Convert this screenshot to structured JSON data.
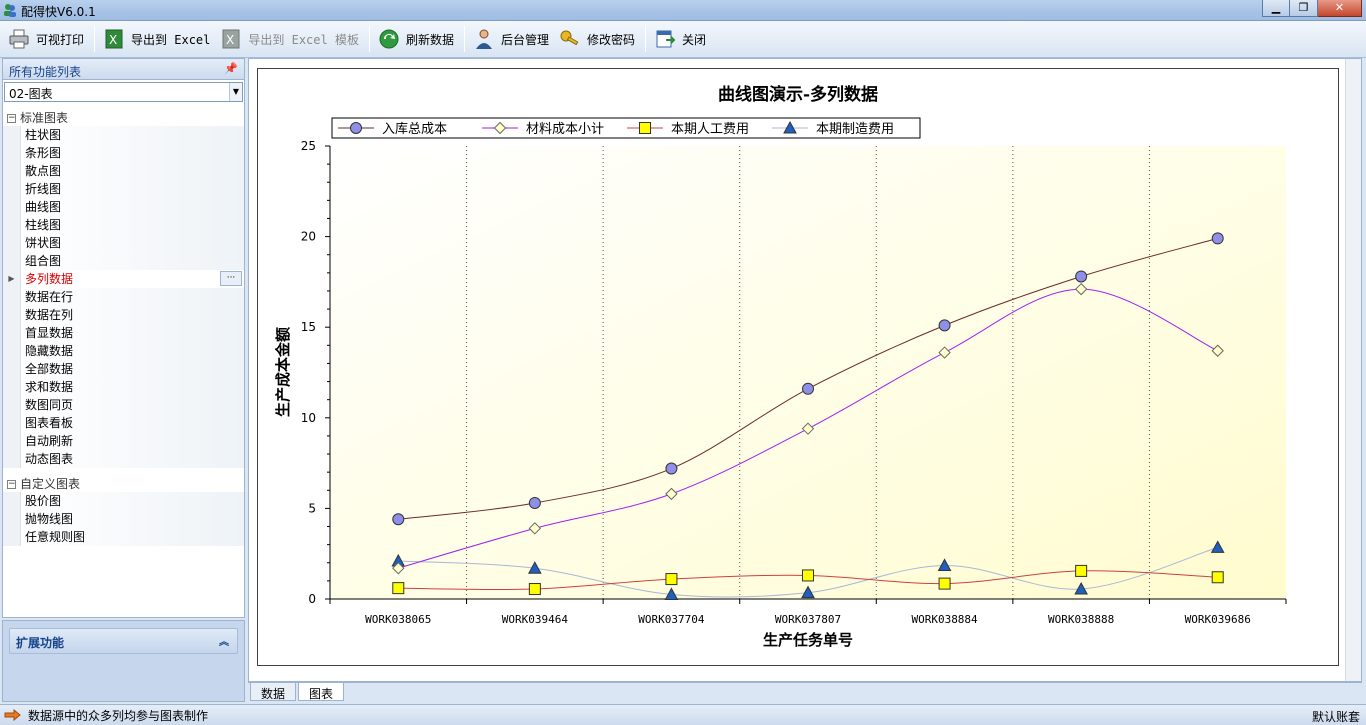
{
  "window": {
    "title": "配得快V6.0.1"
  },
  "toolbar": {
    "print": "可视打印",
    "export_excel": "导出到 Excel",
    "export_template": "导出到 Excel 模板",
    "refresh": "刷新数据",
    "admin": "后台管理",
    "password": "修改密码",
    "close": "关闭"
  },
  "sidebar": {
    "header": "所有功能列表",
    "pin": "ᵖ",
    "combo_value": "02-图表",
    "group1": "标准图表",
    "items1": [
      "柱状图",
      "条形图",
      "散点图",
      "折线图",
      "曲线图",
      "柱线图",
      "饼状图",
      "组合图",
      "多列数据",
      "数据在行",
      "数据在列",
      "首显数据",
      "隐藏数据",
      "全部数据",
      "求和数据",
      "数图同页",
      "图表看板",
      "自动刷新",
      "动态图表"
    ],
    "selected_index": 8,
    "group2": "自定义图表",
    "items2": [
      "股价图",
      "抛物线图",
      "任意规则图"
    ],
    "ext_header": "扩展功能"
  },
  "tabs": [
    "数据",
    "图表"
  ],
  "status": {
    "message": "数据源中的众多列均参与图表制作",
    "right": "默认账套"
  },
  "colors": {
    "s1": "#8f8fe8",
    "s2": "#ffffcc",
    "s3": "#ffff00",
    "s4": "#1f5fbf"
  },
  "chart_data": {
    "type": "line",
    "title": "曲线图演示-多列数据",
    "xlabel": "生产任务单号",
    "ylabel": "生产成本金额",
    "ylim": [
      0,
      25
    ],
    "yticks": [
      0,
      5,
      10,
      15,
      20,
      25
    ],
    "categories": [
      "WORK038065",
      "WORK039464",
      "WORK037704",
      "WORK037807",
      "WORK038884",
      "WORK038888",
      "WORK039686"
    ],
    "legend_placement": "top-left",
    "grid": true,
    "series": [
      {
        "name": "入库总成本",
        "values": [
          4.4,
          5.3,
          7.2,
          11.6,
          15.1,
          17.8,
          19.9
        ],
        "marker": "circle",
        "line": "#6b2a2a"
      },
      {
        "name": "材料成本小计",
        "values": [
          1.7,
          3.9,
          5.8,
          9.4,
          13.6,
          17.1,
          13.7
        ],
        "marker": "diamond",
        "line": "#a020f0"
      },
      {
        "name": "本期人工费用",
        "values": [
          0.6,
          0.55,
          1.1,
          1.3,
          0.85,
          1.55,
          1.2
        ],
        "marker": "square",
        "line": "#d04040"
      },
      {
        "name": "本期制造费用",
        "values": [
          2.1,
          1.7,
          0.25,
          0.35,
          1.85,
          0.55,
          2.85
        ],
        "marker": "triangle",
        "line": "#a8b8d8"
      }
    ]
  }
}
